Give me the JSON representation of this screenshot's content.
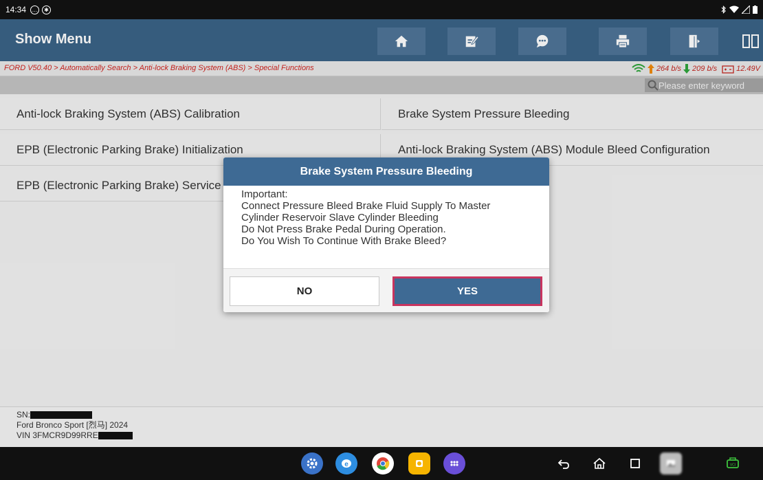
{
  "status_bar": {
    "time": "14:34"
  },
  "header": {
    "title": "Show Menu",
    "tools": [
      {
        "name": "home-icon"
      },
      {
        "name": "edit-report-icon"
      },
      {
        "name": "feedback-icon"
      },
      {
        "name": "print-icon"
      },
      {
        "name": "exit-icon"
      }
    ]
  },
  "breadcrumb": {
    "path": "FORD V50.40 > Automatically Search > Anti-lock Braking System (ABS) > Special Functions",
    "upload": "264 b/s",
    "download": "209 b/s",
    "voltage": "12.49V"
  },
  "search": {
    "placeholder": "Please enter keyword"
  },
  "functions": {
    "left": [
      "Anti-lock Braking System (ABS) Calibration",
      "EPB (Electronic Parking Brake) Initialization",
      "EPB (Electronic Parking Brake) Service"
    ],
    "right": [
      "Brake System Pressure Bleeding",
      "Anti-lock Braking System (ABS) Module Bleed Configuration"
    ]
  },
  "vehicle": {
    "sn_label": "SN:",
    "model": "Ford Bronco Sport [烈马] 2024",
    "vin_prefix": "VIN 3FMCR9D99RRE"
  },
  "dialog": {
    "title": "Brake System Pressure Bleeding",
    "lines": [
      "Important:",
      "Connect Pressure Bleed Brake Fluid Supply To Master",
      "Cylinder Reservoir Slave Cylinder Bleeding",
      "Do Not Press Brake Pedal During Operation.",
      "Do You Wish To Continue With Brake Bleed?"
    ],
    "no_label": "NO",
    "yes_label": "YES"
  },
  "colors": {
    "header": "#3b6387",
    "dialog_title": "#3e6a94",
    "breadcrumb_text": "#d1231f",
    "focus_ring": "#c8345e"
  }
}
